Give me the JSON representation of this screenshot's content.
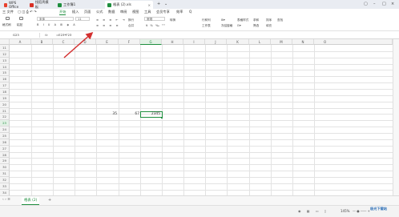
{
  "tabs": [
    {
      "label": "WPS Office",
      "icon": "wps-logo-icon",
      "color": "#e8412e"
    },
    {
      "label": "找稻壳模板",
      "icon": "docer-icon",
      "color": "#d93025"
    },
    {
      "label": "工作簿1",
      "icon": "spreadsheet-icon",
      "color": "#1e8e3e"
    },
    {
      "label": "格表 (2).xls",
      "icon": "spreadsheet-icon",
      "color": "#1e8e3e"
    }
  ],
  "new_tab": "+",
  "menu": {
    "file_label": "三 文件",
    "items": [
      "开始",
      "插入",
      "页面",
      "公式",
      "数据",
      "审阅",
      "视图",
      "工具",
      "会员专享",
      "效率"
    ],
    "active_index": 0,
    "search": "Q"
  },
  "ribbon": {
    "paste_label": "格式刷",
    "paste2_label": "粘贴",
    "font_name": "宋体",
    "font_size": "11",
    "wrap_label": "换行",
    "merge_label": "合并",
    "number_format": "常规",
    "convert_label": "转换",
    "rowcol_label": "行和列",
    "worksheet_label": "工作表",
    "freeze_label": "冻结窗格",
    "table_style_label": "表格样式",
    "sum_label": "求和",
    "filter_label": "筛选",
    "sort_label": "排序",
    "fill_label": "填充",
    "find_label": "查找"
  },
  "formula_bar": {
    "name_box": "G23",
    "fx": "fx",
    "formula": "=E23*F23"
  },
  "grid": {
    "columns": [
      "A",
      "B",
      "C",
      "D",
      "E",
      "F",
      "G",
      "H",
      "I",
      "J",
      "K",
      "L",
      "M",
      "N",
      "O"
    ],
    "selected_column": "G",
    "rows": [
      "11",
      "12",
      "13",
      "14",
      "15",
      "16",
      "17",
      "18",
      "19",
      "20",
      "21",
      "22",
      "23",
      "24",
      "25",
      "26",
      "27",
      "28",
      "29",
      "30",
      "31",
      "32",
      "33",
      "34"
    ],
    "selected_row": "23",
    "cells": {
      "E23": "35",
      "F23": "67",
      "G23": "2345"
    }
  },
  "sheet": {
    "name": "格表 (2)",
    "add": "+"
  },
  "status": {
    "zoom": "145%"
  },
  "watermark": "极光下载站",
  "colors": {
    "accent": "#1e8e3e",
    "arrow": "#d32f2f"
  }
}
